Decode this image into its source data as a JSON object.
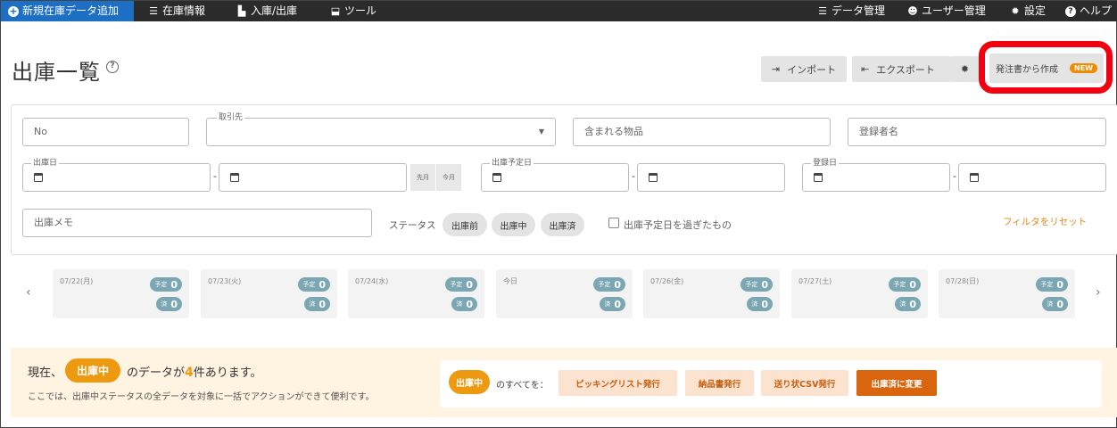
{
  "nav": {
    "new_data": "新規在庫データ追加",
    "inventory": "在庫情報",
    "inout": "入庫/出庫",
    "tools": "ツール",
    "data_mgmt": "データ管理",
    "user_mgmt": "ユーザー管理",
    "settings": "設定",
    "help": "ヘルプ"
  },
  "page": {
    "title": "出庫一覧",
    "help_glyph": "?",
    "import": "インポート",
    "export": "エクスポート",
    "create_from_order": "発注書から作成",
    "new_badge": "NEW"
  },
  "filters": {
    "no_placeholder": "No",
    "partner_label": "取引先",
    "contains_item_placeholder": "含まれる物品",
    "registrant_placeholder": "登録者名",
    "ship_date_label": "出庫日",
    "last_month": "先月",
    "this_month": "今月",
    "scheduled_date_label": "出庫予定日",
    "registered_date_label": "登録日",
    "memo_placeholder": "出庫メモ",
    "status_label": "ステータス",
    "status_options": [
      "出庫前",
      "出庫中",
      "出庫済"
    ],
    "overdue_label": "出庫予定日を過ぎたもの",
    "reset": "フィルタをリセット",
    "date_sep": "-"
  },
  "days": [
    {
      "date": "07/22(月)",
      "planned": "0",
      "done": "0"
    },
    {
      "date": "07/23(火)",
      "planned": "0",
      "done": "0"
    },
    {
      "date": "07/24(水)",
      "planned": "0",
      "done": "0"
    },
    {
      "date": "今日",
      "planned": "0",
      "done": "0"
    },
    {
      "date": "07/26(金)",
      "planned": "0",
      "done": "0"
    },
    {
      "date": "07/27(土)",
      "planned": "0",
      "done": "0"
    },
    {
      "date": "07/28(日)",
      "planned": "0",
      "done": "0"
    }
  ],
  "day_labels": {
    "planned": "予定",
    "done": "済"
  },
  "summary": {
    "prefix": "現在、",
    "status": "出庫中",
    "mid": "のデータが",
    "count": "4",
    "suffix": "件あります。",
    "desc": "ここでは、出庫中ステータスの全データを対象に一括でアクションができて便利です。"
  },
  "actions": {
    "status": "出庫中",
    "all_label": "のすべてを：",
    "picking": "ピッキングリスト発行",
    "delivery": "納品書発行",
    "csv": "送り状CSV発行",
    "change": "出庫済に変更"
  },
  "colors": {
    "accent": "#1d6fc4",
    "orange": "#ee9a11",
    "highlight": "#f2000f"
  }
}
